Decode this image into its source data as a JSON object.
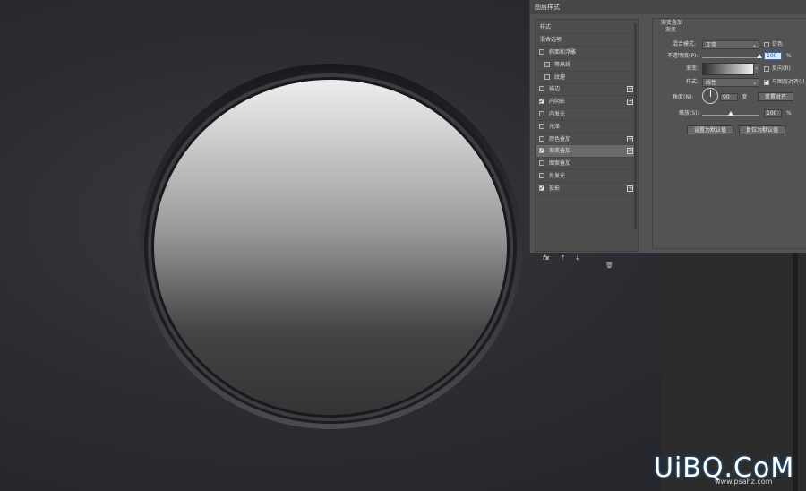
{
  "dialog": {
    "title": "图层样式",
    "styles_header": "样式",
    "blend_options": "混合选项",
    "style_items": [
      {
        "label": "斜面和浮雕",
        "checked": false,
        "indent": false,
        "plus": false,
        "selected": false
      },
      {
        "label": "等高线",
        "checked": false,
        "indent": true,
        "plus": false,
        "selected": false
      },
      {
        "label": "纹理",
        "checked": false,
        "indent": true,
        "plus": false,
        "selected": false
      },
      {
        "label": "描边",
        "checked": false,
        "indent": false,
        "plus": true,
        "selected": false
      },
      {
        "label": "内阴影",
        "checked": true,
        "indent": false,
        "plus": true,
        "selected": false
      },
      {
        "label": "内发光",
        "checked": false,
        "indent": false,
        "plus": false,
        "selected": false
      },
      {
        "label": "光泽",
        "checked": false,
        "indent": false,
        "plus": false,
        "selected": false
      },
      {
        "label": "颜色叠加",
        "checked": false,
        "indent": false,
        "plus": true,
        "selected": false
      },
      {
        "label": "渐变叠加",
        "checked": true,
        "indent": false,
        "plus": true,
        "selected": true
      },
      {
        "label": "图案叠加",
        "checked": false,
        "indent": false,
        "plus": false,
        "selected": false
      },
      {
        "label": "外发光",
        "checked": false,
        "indent": false,
        "plus": false,
        "selected": false
      },
      {
        "label": "投影",
        "checked": true,
        "indent": false,
        "plus": true,
        "selected": false
      }
    ],
    "footer_fx": "fx"
  },
  "gradient_overlay": {
    "section_title": "渐变叠加",
    "group_title": "渐变",
    "blend_mode_label": "混合模式:",
    "blend_mode_value": "正常",
    "dither_label": "仿色",
    "opacity_label": "不透明度(P):",
    "opacity_value": "100",
    "percent": "%",
    "gradient_label": "渐变:",
    "reverse_label": "反向(R)",
    "style_label": "样式:",
    "style_value": "线性",
    "align_label": "与图层对齐(I)",
    "angle_label": "角度(N):",
    "angle_value": "90",
    "degree": "度",
    "reset_align_button": "重置对齐",
    "scale_label": "缩放(S):",
    "scale_value": "100",
    "percent2": "%",
    "set_default_button": "设置为默认值",
    "reset_default_button": "复位为默认值",
    "opacity_level": 1.0,
    "scale_level": 0.5
  },
  "watermark": {
    "text": "UiBQ.CoM",
    "sub": "www.psahz.com"
  },
  "colors": {
    "dialog_bg": "#535353",
    "selection": "#6a6a6a",
    "focus_blue": "#2d6ad1"
  }
}
